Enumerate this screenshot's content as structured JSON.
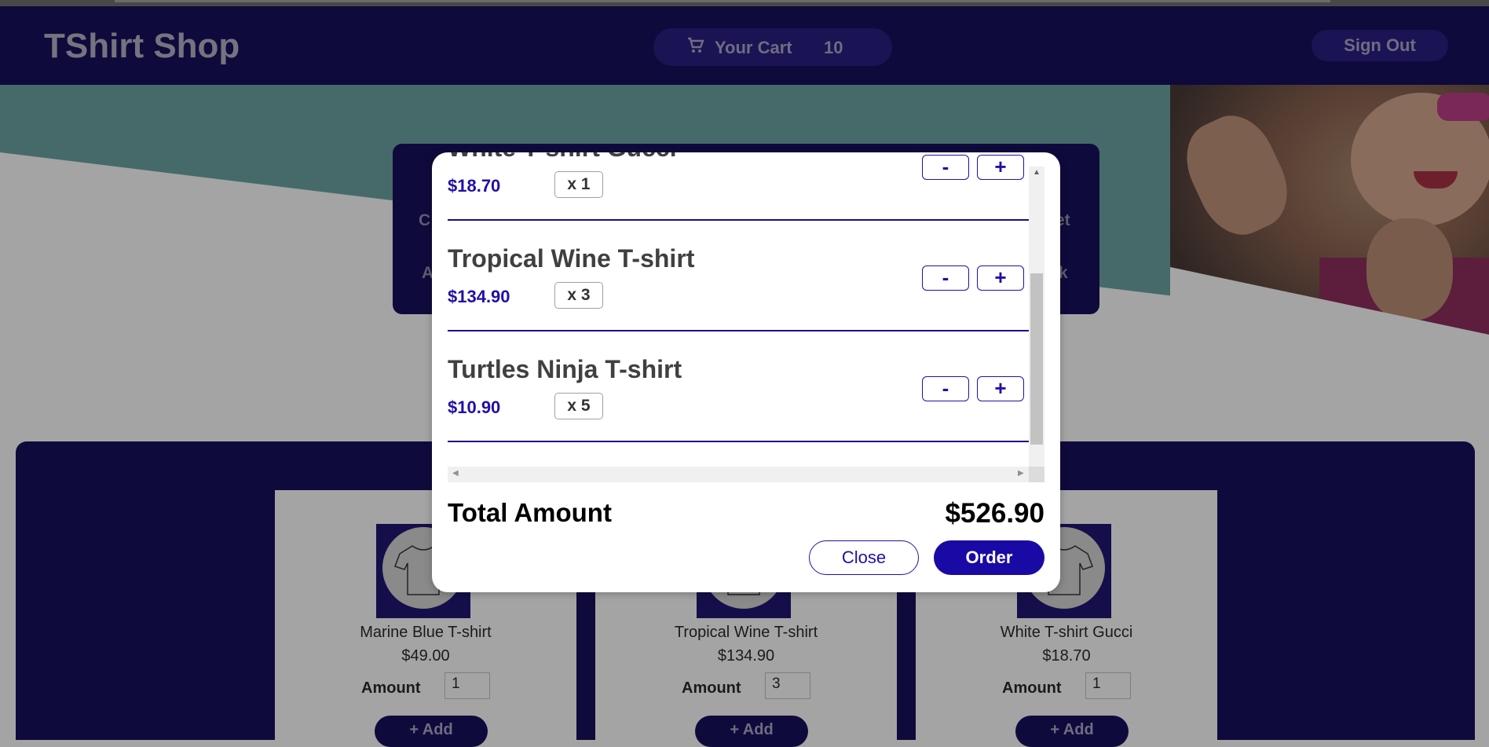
{
  "header": {
    "brand": "TShirt Shop",
    "cart_label": "Your Cart",
    "cart_count": "10",
    "sign_out": "Sign Out"
  },
  "hero": {
    "partial_labels": [
      "C",
      "A",
      "et",
      "k"
    ]
  },
  "products": [
    {
      "name": "Marine Blue T-shirt",
      "price": "$49.00",
      "amount_label": "Amount",
      "amount": "1",
      "add_label": "+ Add"
    },
    {
      "name": "Tropical Wine T-shirt",
      "price": "$134.90",
      "amount_label": "Amount",
      "amount": "3",
      "add_label": "+ Add"
    },
    {
      "name": "White T-shirt Gucci",
      "price": "$18.70",
      "amount_label": "Amount",
      "amount": "1",
      "add_label": "+ Add"
    }
  ],
  "cart_modal": {
    "items": [
      {
        "name": "White T-shirt Gucci",
        "price": "$18.70",
        "qty": "x 1",
        "minus": "-",
        "plus": "+"
      },
      {
        "name": "Tropical Wine T-shirt",
        "price": "$134.90",
        "qty": "x 3",
        "minus": "-",
        "plus": "+"
      },
      {
        "name": "Turtles Ninja T-shirt",
        "price": "$10.90",
        "qty": "x 5",
        "minus": "-",
        "plus": "+"
      }
    ],
    "total_label": "Total Amount",
    "total_value": "$526.90",
    "close_label": "Close",
    "order_label": "Order"
  },
  "colors": {
    "accent": "#1a0aa5",
    "header_bg": "#0f0a3c",
    "price_text": "#2010a8"
  },
  "icons": [
    "cart-icon",
    "tshirt-icon"
  ]
}
